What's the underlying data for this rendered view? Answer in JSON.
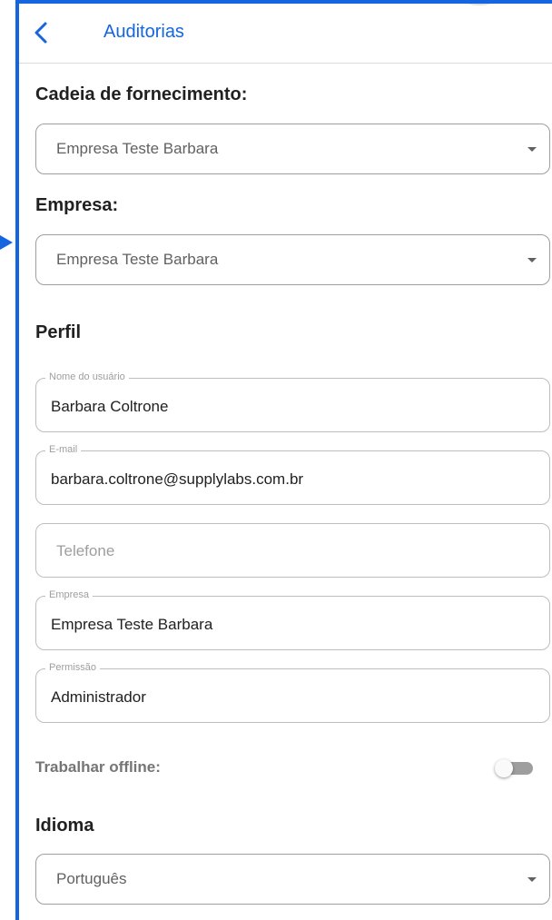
{
  "header": {
    "title": "Auditorias",
    "back_icon": "chevron-left-icon"
  },
  "supply_chain": {
    "label": "Cadeia de fornecimento:",
    "selected": "Empresa Teste Barbara"
  },
  "company_select": {
    "label": "Empresa:",
    "selected": "Empresa Teste Barbara"
  },
  "profile": {
    "heading": "Perfil",
    "username": {
      "label": "Nome do usuário",
      "value": "Barbara Coltrone"
    },
    "email": {
      "label": "E-mail",
      "value": "barbara.coltrone@supplylabs.com.br"
    },
    "phone": {
      "placeholder": "Telefone"
    },
    "company": {
      "label": "Empresa",
      "value": "Empresa Teste Barbara"
    },
    "permission": {
      "label": "Permissão",
      "value": "Administrador"
    }
  },
  "offline": {
    "label": "Trabalhar offline:",
    "enabled": false
  },
  "language": {
    "heading": "Idioma",
    "selected": "Português"
  },
  "colors": {
    "accent": "#1565e0",
    "text": "#212121",
    "muted": "#9e9e9e"
  }
}
